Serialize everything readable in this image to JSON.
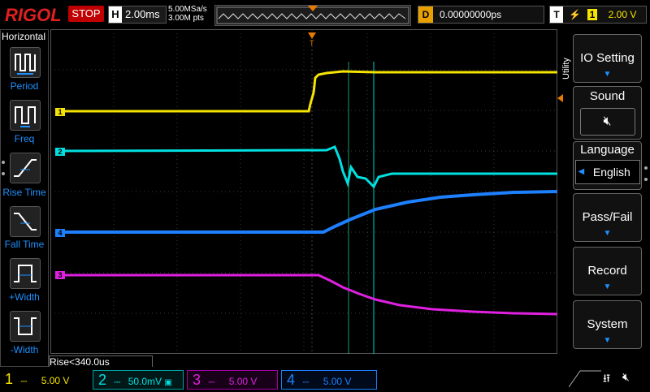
{
  "header": {
    "brand": "RIGOL",
    "run_state": "STOP",
    "timebase_label": "H",
    "timebase_value": "2.00ms",
    "sample_rate": "5.00MSa/s",
    "memory_depth": "3.00M pts",
    "delay_label": "D",
    "delay_value": "0.00000000ps",
    "trigger_label": "T",
    "trigger_channel": "1",
    "trigger_level": "2.00 V"
  },
  "left_panel": {
    "title": "Horizontal",
    "items": [
      {
        "label": "Period",
        "icon": "period-icon"
      },
      {
        "label": "Freq",
        "icon": "frequency-icon"
      },
      {
        "label": "Rise Time",
        "icon": "rise-time-icon"
      },
      {
        "label": "Fall Time",
        "icon": "fall-time-icon"
      },
      {
        "label": "+Width",
        "icon": "positive-width-icon"
      },
      {
        "label": "-Width",
        "icon": "negative-width-icon"
      }
    ]
  },
  "right_menu": {
    "tab_label": "Utility",
    "items": [
      {
        "label": "IO Setting"
      },
      {
        "label": "Sound"
      },
      {
        "label": "Language",
        "value": "English"
      },
      {
        "label": "Pass/Fail"
      },
      {
        "label": "Record"
      },
      {
        "label": "System"
      }
    ]
  },
  "measurement": {
    "text": "Rise<340.0us"
  },
  "channels": [
    {
      "id": "1",
      "scale": "5.00 V",
      "color": "#f5e400"
    },
    {
      "id": "2",
      "scale": "50.0mV",
      "color": "#00e0e0"
    },
    {
      "id": "3",
      "scale": "5.00 V",
      "color": "#e020e0"
    },
    {
      "id": "4",
      "scale": "5.00 V",
      "color": "#1e7fff"
    }
  ],
  "trace_markers": [
    "1",
    "2",
    "4",
    "3"
  ]
}
